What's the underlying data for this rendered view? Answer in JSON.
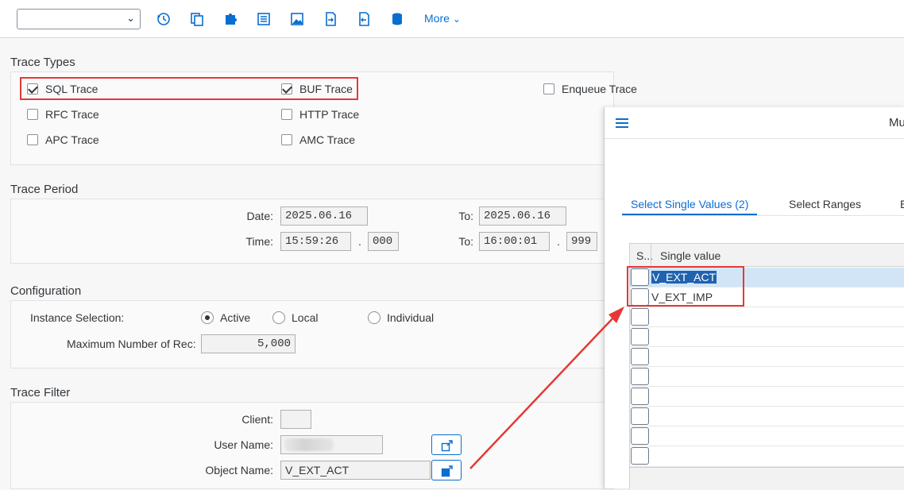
{
  "toolbar": {
    "variant_value": "",
    "icons": [
      "history-icon",
      "copy-icon",
      "puzzle-icon",
      "list-icon",
      "image-icon",
      "document-export-icon",
      "document-import-icon",
      "database-icon"
    ],
    "more_label": "More"
  },
  "trace_types": {
    "title": "Trace Types",
    "items": [
      {
        "label": "SQL Trace",
        "checked": true
      },
      {
        "label": "BUF Trace",
        "checked": true
      },
      {
        "label": "Enqueue Trace",
        "checked": false
      },
      {
        "label": "RFC Trace",
        "checked": false
      },
      {
        "label": "HTTP Trace",
        "checked": false
      },
      {
        "label": "APC Trace",
        "checked": false
      },
      {
        "label": "AMC Trace",
        "checked": false
      }
    ]
  },
  "trace_period": {
    "title": "Trace Period",
    "date_label": "Date:",
    "date_from": "2025.06.16",
    "to_label": "To:",
    "date_to": "2025.06.16",
    "time_label": "Time:",
    "time_from": "15:59:26",
    "ms_from": "000",
    "time_to": "16:00:01",
    "ms_to": "999",
    "dot": "."
  },
  "configuration": {
    "title": "Configuration",
    "instance_label": "Instance Selection:",
    "options": [
      {
        "label": "Active",
        "selected": true
      },
      {
        "label": "Local",
        "selected": false
      },
      {
        "label": "Individual",
        "selected": false
      }
    ],
    "max_label": "Maximum Number of Rec:",
    "max_value": "5,000"
  },
  "trace_filter": {
    "title": "Trace Filter",
    "client_label": "Client:",
    "client_value": "",
    "user_label": "User Name:",
    "object_label": "Object Name:",
    "object_value": "V_EXT_ACT"
  },
  "dialog": {
    "title": "Mu",
    "tabs": [
      "Select Single Values (2)",
      "Select Ranges",
      "E"
    ],
    "col_select": "S...",
    "col_value": "Single value",
    "rows": [
      "V_EXT_ACT",
      "V_EXT_IMP",
      "",
      "",
      "",
      "",
      "",
      "",
      "",
      ""
    ]
  },
  "colors": {
    "accent": "#0a6ed1",
    "annotation_red": "#e53935"
  }
}
